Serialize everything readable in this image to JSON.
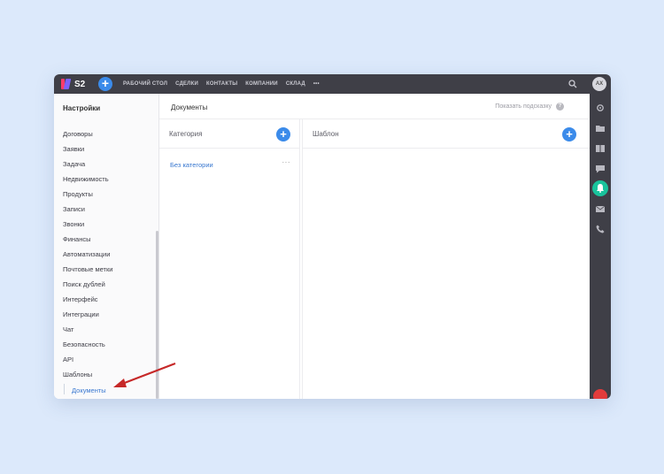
{
  "app": {
    "logo_text": "S2",
    "add_label": "+"
  },
  "nav": [
    "РАБОЧИЙ СТОЛ",
    "СДЕЛКИ",
    "КОНТАКТЫ",
    "КОМПАНИИ",
    "СКЛАД",
    "•••"
  ],
  "user": {
    "initials": "АХ"
  },
  "sidebar": {
    "title": "Настройки",
    "items": [
      "Договоры",
      "Заявки",
      "Задача",
      "Недвижимость",
      "Продукты",
      "Записи",
      "Звонки",
      "Финансы",
      "Автоматизации",
      "Почтовые метки",
      "Поиск дублей",
      "Интерфейс",
      "Интеграции",
      "Чат",
      "Безопасность",
      "API",
      "Шаблоны"
    ],
    "active_item": "Документы"
  },
  "header": {
    "title": "Документы",
    "hint": "Показать подсказку",
    "hint_icon": "?"
  },
  "category_panel": {
    "title": "Категория",
    "add": "+",
    "rows": [
      {
        "label": "Без категории",
        "more": "···"
      }
    ]
  },
  "template_panel": {
    "title": "Шаблон",
    "add": "+"
  },
  "colors": {
    "accent": "#3b8bea",
    "topbar": "#3f3f47",
    "link": "#3978d0",
    "arrow": "#c62828",
    "bell": "#19c39c"
  }
}
